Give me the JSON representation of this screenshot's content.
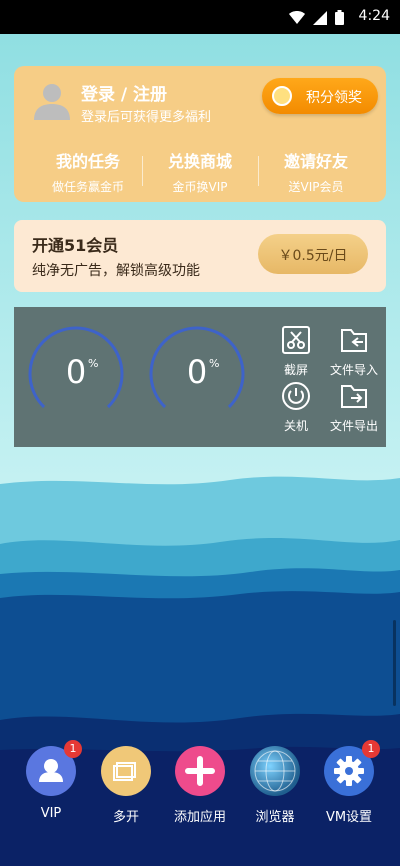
{
  "status_bar": {
    "time": "4:24"
  },
  "login_card": {
    "title": "登录 / 注册",
    "subtitle": "登录后可获得更多福利",
    "points_button": "积分领奖",
    "features": [
      {
        "title": "我的任务",
        "sub": "做任务赢金币"
      },
      {
        "title": "兑换商城",
        "sub": "金币换VIP"
      },
      {
        "title": "邀请好友",
        "sub": "送VIP会员"
      }
    ]
  },
  "vip_card": {
    "title": "开通51会员",
    "subtitle": "纯净无广告，解锁高级功能",
    "price": "￥0.5元/日"
  },
  "panel": {
    "gauges": [
      {
        "value": "0",
        "unit": "%"
      },
      {
        "value": "0",
        "unit": "%"
      }
    ],
    "tools": [
      {
        "label": "截屏",
        "icon": "screenshot-icon"
      },
      {
        "label": "文件导入",
        "icon": "folder-import-icon"
      },
      {
        "label": "关机",
        "icon": "power-icon"
      },
      {
        "label": "文件导出",
        "icon": "folder-export-icon"
      }
    ]
  },
  "dock": [
    {
      "label": "VIP",
      "icon": "person-icon",
      "badge": "1",
      "color": "#5a77e0"
    },
    {
      "label": "多开",
      "icon": "multi-window-icon",
      "badge": "",
      "color": "#f0c878"
    },
    {
      "label": "添加应用",
      "icon": "plus-icon",
      "badge": "",
      "color": "#ee4b8c"
    },
    {
      "label": "浏览器",
      "icon": "globe-icon",
      "badge": "",
      "color": "#2a7fb0"
    },
    {
      "label": "VM设置",
      "icon": "gear-icon",
      "badge": "1",
      "color": "#3a70d8"
    }
  ],
  "colors": {
    "login_card": "#f6cd86",
    "vip_card": "#fde9d3",
    "panel": "#5f7373",
    "gauge_arc": "#3e63c9",
    "price_button": "#e7b866"
  }
}
